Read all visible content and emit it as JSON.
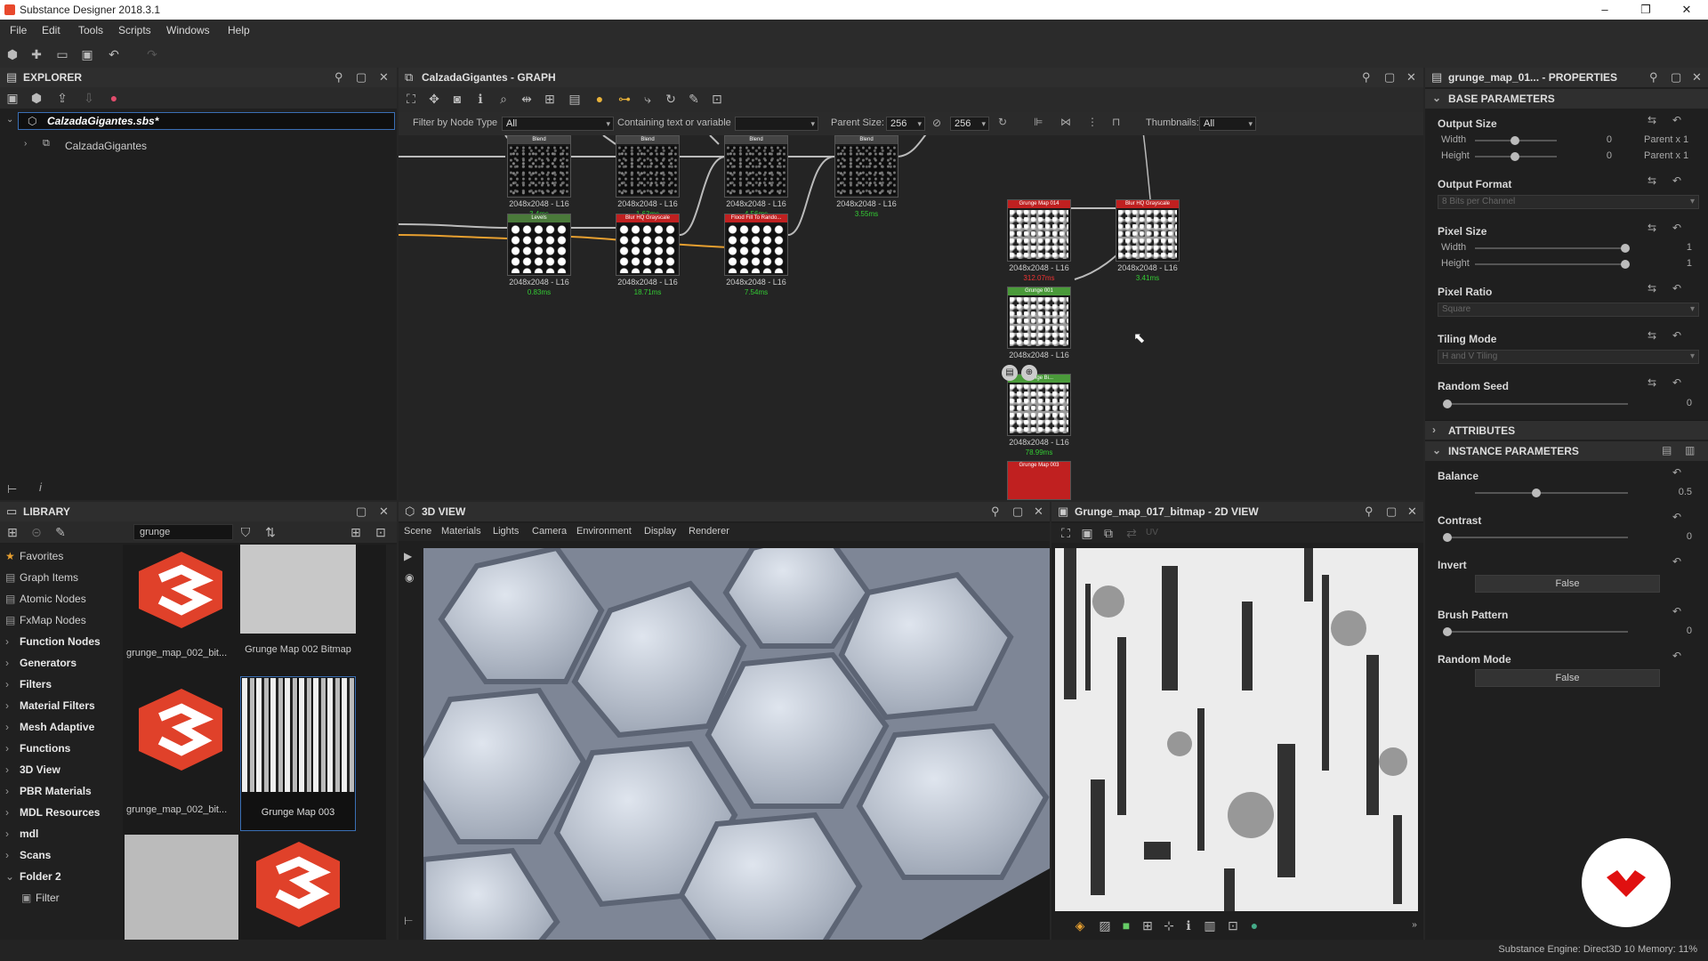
{
  "app": {
    "title": "Substance Designer 2018.3.1"
  },
  "menu": [
    "File",
    "Edit",
    "Tools",
    "Scripts",
    "Windows",
    "Help"
  ],
  "explorer": {
    "title": "EXPLORER",
    "file": "CalzadaGigantes.sbs*",
    "graph": "CalzadaGigantes"
  },
  "graph": {
    "title": "CalzadaGigantes - GRAPH",
    "filter_label": "Filter by Node Type",
    "filter_value": "All",
    "contain_label": "Containing text or variable",
    "parent_size_label": "Parent Size:",
    "size_w": "256",
    "size_h": "256",
    "thumbnails_label": "Thumbnails:",
    "thumbnails_value": "All",
    "nodes": [
      {
        "title": "Blend",
        "res": "2048x2048 - L16",
        "time": "3.4ms"
      },
      {
        "title": "Blend",
        "res": "2048x2048 - L16",
        "time": "1.63ms"
      },
      {
        "title": "Blend",
        "res": "2048x2048 - L16",
        "time": "4.56ms"
      },
      {
        "title": "Blend",
        "res": "2048x2048 - L16",
        "time": "3.55ms"
      },
      {
        "title": "Levels",
        "res": "2048x2048 - L16",
        "time": "0.83ms"
      },
      {
        "title": "Blur HQ Grayscale",
        "res": "2048x2048 - L16",
        "time": "18.71ms"
      },
      {
        "title": "Flood Fill To Rando...",
        "res": "2048x2048 - L16",
        "time": "7.54ms"
      },
      {
        "title": "Grunge Map 014",
        "res": "2048x2048 - L16",
        "time": "312.07ms"
      },
      {
        "title": "Blur HQ Grayscale",
        "res": "2048x2048 - L16",
        "time": "3.41ms"
      },
      {
        "title": "Grunge 001",
        "res": "2048x2048 - L16",
        "time": ""
      },
      {
        "title": "Grunge Bi...",
        "res": "2048x2048 - L16",
        "time": "78.99ms"
      },
      {
        "title": "Grunge Map 003",
        "res": "",
        "time": ""
      }
    ]
  },
  "properties": {
    "title": "grunge_map_01... - PROPERTIES",
    "base": "BASE PARAMETERS",
    "output_size": "Output Size",
    "width": "Width",
    "height": "Height",
    "out_w_val": "0",
    "out_h_val": "0",
    "out_w_rel": "Parent x 1",
    "out_h_rel": "Parent x 1",
    "output_format": "Output Format",
    "output_format_val": "8 Bits per Channel",
    "pixel_size": "Pixel Size",
    "px_w_val": "1",
    "px_h_val": "1",
    "pixel_ratio": "Pixel Ratio",
    "pixel_ratio_val": "Square",
    "tiling_mode": "Tiling Mode",
    "tiling_mode_val": "H and V Tiling",
    "random_seed": "Random Seed",
    "random_seed_val": "0",
    "attributes": "ATTRIBUTES",
    "instance": "INSTANCE PARAMETERS",
    "balance": "Balance",
    "balance_val": "0.5",
    "contrast": "Contrast",
    "contrast_val": "0",
    "invert": "Invert",
    "invert_val": "False",
    "brush_pattern": "Brush Pattern",
    "brush_pattern_val": "0",
    "random_mode": "Random Mode",
    "random_mode_val": "False"
  },
  "library": {
    "title": "LIBRARY",
    "search": "grunge",
    "tree": [
      "Favorites",
      "Graph Items",
      "Atomic Nodes",
      "FxMap Nodes",
      "Function Nodes",
      "Generators",
      "Filters",
      "Material Filters",
      "Mesh Adaptive",
      "Functions",
      "3D View",
      "PBR Materials",
      "MDL Resources",
      "mdl",
      "Scans",
      "Folder 2",
      "Filter"
    ],
    "thumbs": [
      "grunge_map_002_bit...",
      "Grunge Map 002 Bitmap",
      "grunge_map_002_bit...",
      "Grunge Map 003"
    ]
  },
  "view3d": {
    "title": "3D VIEW",
    "menus": [
      "Scene",
      "Materials",
      "Lights",
      "Camera",
      "Environment",
      "Display",
      "Renderer"
    ]
  },
  "view2d": {
    "title": "Grunge_map_017_bitmap - 2D VIEW",
    "uv": "UV"
  },
  "status": {
    "text": "Substance Engine: Direct3D 10  Memory: 11%"
  }
}
